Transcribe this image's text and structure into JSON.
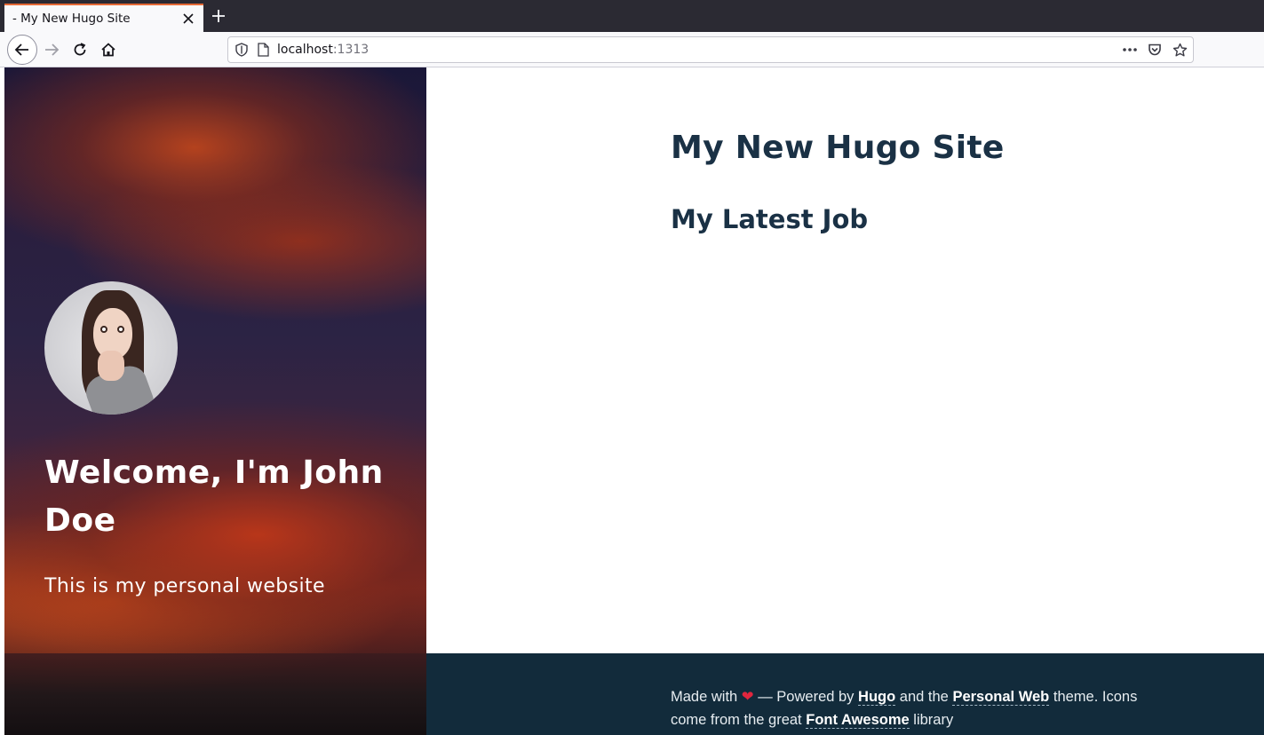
{
  "browser": {
    "tab_title": "- My New Hugo Site",
    "url_host": "localhost",
    "url_port": ":1313"
  },
  "sidebar": {
    "welcome": "Welcome, I'm John Doe",
    "tagline": "This is my personal website"
  },
  "main": {
    "site_title": "My New Hugo Site",
    "section_heading": "My Latest Job"
  },
  "footer": {
    "made_with": "Made with",
    "heart": "❤",
    "powered_by": "— Powered by",
    "hugo_link": "Hugo",
    "and_the": "and the",
    "theme_link": "Personal Web",
    "theme_icons": "theme. Icons come from the great",
    "fa_link": "Font Awesome",
    "library": "library"
  },
  "colors": {
    "heading": "#1a3145",
    "footer_bg": "#122b3b",
    "heart": "#e0263e"
  }
}
